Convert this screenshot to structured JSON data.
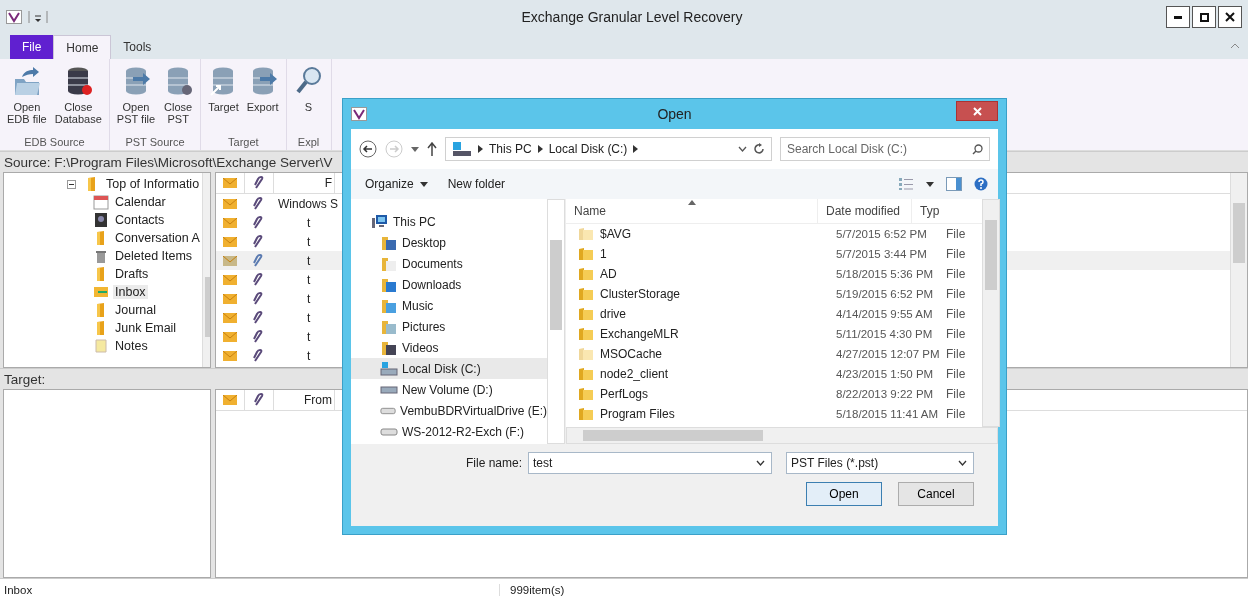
{
  "window": {
    "title": "Exchange Granular Level Recovery"
  },
  "ribbon_tabs": [
    {
      "label": "File",
      "kind": "backstage",
      "selected": false
    },
    {
      "label": "Home",
      "kind": "tab",
      "selected": true
    },
    {
      "label": "Tools",
      "kind": "tab",
      "selected": false
    }
  ],
  "ribbon_groups": [
    {
      "label": "EDB Source",
      "buttons": [
        {
          "lines": [
            "Open",
            "EDB file"
          ],
          "kind": "open-folder"
        },
        {
          "lines": [
            "Close",
            "Database"
          ],
          "kind": "close-db-red"
        }
      ]
    },
    {
      "label": "PST Source",
      "buttons": [
        {
          "lines": [
            "Open",
            "PST file"
          ],
          "kind": "open-db"
        },
        {
          "lines": [
            "Close",
            "PST"
          ],
          "kind": "close-db"
        }
      ]
    },
    {
      "label": "Target",
      "buttons": [
        {
          "lines": [
            "Target"
          ],
          "kind": "target-db"
        },
        {
          "lines": [
            "Export"
          ],
          "kind": "export-db"
        }
      ]
    },
    {
      "label": "Expl",
      "buttons": [
        {
          "lines": [
            "S"
          ],
          "kind": "search"
        }
      ]
    }
  ],
  "source_path": "Source: F:\\Program Files\\Microsoft\\Exchange Server\\V",
  "tree": [
    {
      "label": "Top of Informatio",
      "kind": "folder",
      "expanded": true,
      "selected": false,
      "children": [
        {
          "label": "Calendar",
          "kind": "calendar",
          "selected": false
        },
        {
          "label": "Contacts",
          "kind": "contacts",
          "selected": false
        },
        {
          "label": "Conversation A",
          "kind": "folder",
          "selected": false
        },
        {
          "label": "Deleted Items",
          "kind": "trash",
          "selected": false
        },
        {
          "label": "Drafts",
          "kind": "folder",
          "selected": false
        },
        {
          "label": "Inbox",
          "kind": "inbox",
          "selected": true
        },
        {
          "label": "Journal",
          "kind": "folder",
          "selected": false
        },
        {
          "label": "Junk Email",
          "kind": "folder",
          "selected": false
        },
        {
          "label": "Notes",
          "kind": "notes",
          "selected": false
        }
      ]
    }
  ],
  "message_list": {
    "columns": [
      "F"
    ],
    "rows": [
      {
        "from": "Windows S",
        "selected": false
      },
      {
        "from": "t",
        "selected": false
      },
      {
        "from": "t",
        "selected": false
      },
      {
        "from": "t",
        "selected": true
      },
      {
        "from": "t",
        "selected": false
      },
      {
        "from": "t",
        "selected": false
      },
      {
        "from": "t",
        "selected": false
      },
      {
        "from": "t",
        "selected": false
      },
      {
        "from": "t",
        "selected": false
      }
    ]
  },
  "target_label": "Target:",
  "target_list": {
    "columns": [
      "From"
    ]
  },
  "status_bar": {
    "folder": "Inbox",
    "count": "999item(s)"
  },
  "dialog": {
    "title": "Open",
    "path": [
      "This PC",
      "Local Disk (C:)"
    ],
    "search": {
      "placeholder": "Search Local Disk (C:)"
    },
    "toolbar": [
      "Organize",
      "New folder"
    ],
    "nav": [
      {
        "label": "This PC",
        "kind": "pc",
        "selected": false,
        "children": [
          {
            "label": "Desktop",
            "kind": "desktop",
            "selected": false
          },
          {
            "label": "Documents",
            "kind": "documents",
            "selected": false
          },
          {
            "label": "Downloads",
            "kind": "downloads",
            "selected": false
          },
          {
            "label": "Music",
            "kind": "music",
            "selected": false
          },
          {
            "label": "Pictures",
            "kind": "pictures",
            "selected": false
          },
          {
            "label": "Videos",
            "kind": "videos",
            "selected": false
          },
          {
            "label": "Local Disk (C:)",
            "kind": "system-drive",
            "selected": true
          },
          {
            "label": "New Volume (D:)",
            "kind": "volume",
            "selected": false
          },
          {
            "label": "VembuBDRVirtualDrive (E:)",
            "kind": "drive",
            "selected": false
          },
          {
            "label": "WS-2012-R2-Exch (F:)",
            "kind": "drive",
            "selected": false
          }
        ]
      }
    ],
    "columns": [
      "Name",
      "Date modified",
      "Typ"
    ],
    "files": [
      {
        "name": "$AVG",
        "date": "5/7/2015 6:52 PM",
        "type": "File",
        "hidden": true
      },
      {
        "name": "1",
        "date": "5/7/2015 3:44 PM",
        "type": "File",
        "hidden": false
      },
      {
        "name": "AD",
        "date": "5/18/2015 5:36 PM",
        "type": "File",
        "hidden": false
      },
      {
        "name": "ClusterStorage",
        "date": "5/19/2015 6:52 PM",
        "type": "File",
        "hidden": false
      },
      {
        "name": "drive",
        "date": "4/14/2015 9:55 AM",
        "type": "File",
        "hidden": false
      },
      {
        "name": "ExchangeMLR",
        "date": "5/11/2015 4:30 PM",
        "type": "File",
        "hidden": false
      },
      {
        "name": "MSOCache",
        "date": "4/27/2015 12:07 PM",
        "type": "File",
        "hidden": true
      },
      {
        "name": "node2_client",
        "date": "4/23/2015 1:50 PM",
        "type": "File",
        "hidden": false
      },
      {
        "name": "PerfLogs",
        "date": "8/22/2013 9:22 PM",
        "type": "File",
        "hidden": false
      },
      {
        "name": "Program Files",
        "date": "5/18/2015 11:41 AM",
        "type": "File",
        "hidden": false
      }
    ],
    "file_name": {
      "label": "File name:",
      "value": "test"
    },
    "file_type": "PST Files (*.pst)",
    "buttons": [
      "Open",
      "Cancel"
    ]
  }
}
